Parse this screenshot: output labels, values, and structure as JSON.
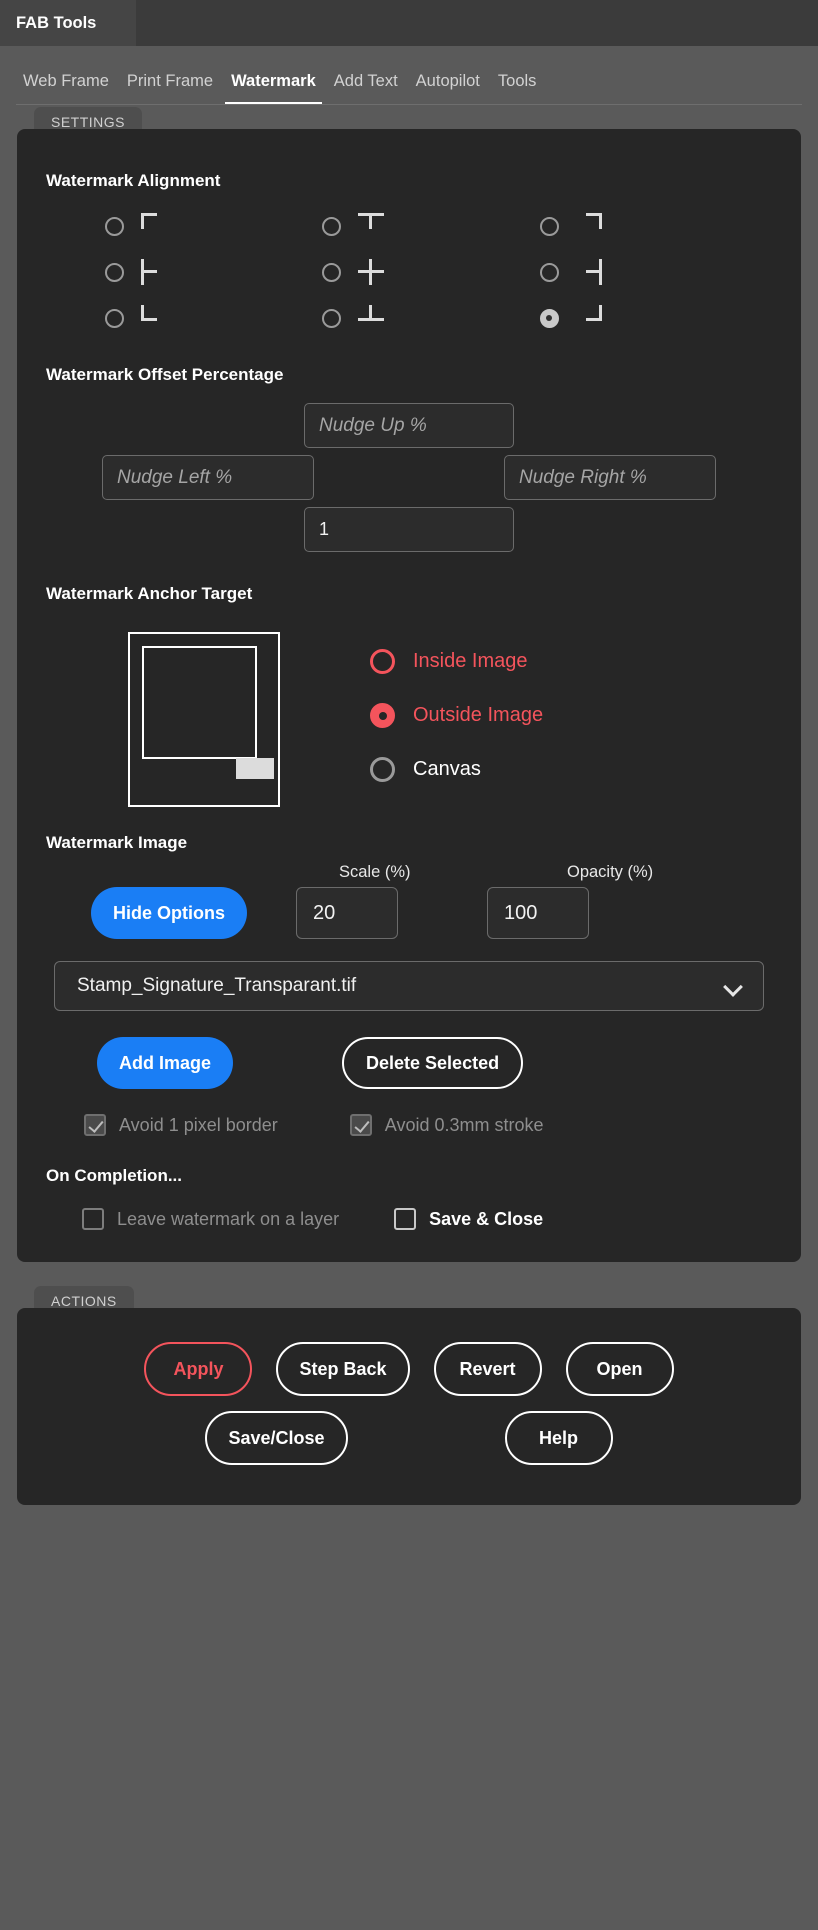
{
  "window": {
    "app_tab_label": "FAB Tools"
  },
  "nav": {
    "tabs": [
      {
        "label": "Web Frame",
        "active": false
      },
      {
        "label": "Print Frame",
        "active": false
      },
      {
        "label": "Watermark",
        "active": true
      },
      {
        "label": "Add Text",
        "active": false
      },
      {
        "label": "Autopilot",
        "active": false
      },
      {
        "label": "Tools",
        "active": false
      }
    ]
  },
  "settings_panel": {
    "tag": "SETTINGS",
    "alignment": {
      "title": "Watermark Alignment",
      "options": [
        {
          "name": "top-left",
          "selected": false
        },
        {
          "name": "top-center",
          "selected": false
        },
        {
          "name": "top-right",
          "selected": false
        },
        {
          "name": "middle-left",
          "selected": false
        },
        {
          "name": "middle-center",
          "selected": false
        },
        {
          "name": "middle-right",
          "selected": false
        },
        {
          "name": "bottom-left",
          "selected": false
        },
        {
          "name": "bottom-center",
          "selected": false
        },
        {
          "name": "bottom-right",
          "selected": true
        }
      ]
    },
    "offset": {
      "title": "Watermark Offset Percentage",
      "nudge_up_placeholder": "Nudge Up %",
      "nudge_up_value": "",
      "nudge_left_placeholder": "Nudge Left %",
      "nudge_left_value": "",
      "nudge_right_placeholder": "Nudge Right %",
      "nudge_right_value": "",
      "nudge_down_placeholder": "",
      "nudge_down_value": "1"
    },
    "anchor": {
      "title": "Watermark Anchor Target",
      "options": [
        {
          "label": "Inside Image",
          "selected": false,
          "color": "#f4545c"
        },
        {
          "label": "Outside Image",
          "selected": true,
          "color": "#f4545c"
        },
        {
          "label": "Canvas",
          "selected": false,
          "color": "#9a9a9a"
        }
      ]
    },
    "image": {
      "title": "Watermark Image",
      "scale_label": "Scale (%)",
      "scale_value": "20",
      "opacity_label": "Opacity (%)",
      "opacity_value": "100",
      "hide_options_label": "Hide Options",
      "selected_file": "Stamp_Signature_Transparant.tif",
      "add_image_label": "Add Image",
      "delete_selected_label": "Delete Selected",
      "avoid_border_label": "Avoid 1 pixel border",
      "avoid_border_checked": true,
      "avoid_stroke_label": "Avoid 0.3mm stroke",
      "avoid_stroke_checked": true
    },
    "on_completion": {
      "title": "On Completion...",
      "leave_layer_label": "Leave watermark on a layer",
      "leave_layer_checked": false,
      "save_close_label": "Save & Close",
      "save_close_checked": false
    }
  },
  "actions_panel": {
    "tag": "ACTIONS",
    "row1": [
      {
        "label": "Apply",
        "accent": "#f4545c"
      },
      {
        "label": "Step Back",
        "accent": "#ffffff"
      },
      {
        "label": "Revert",
        "accent": "#ffffff"
      },
      {
        "label": "Open",
        "accent": "#ffffff"
      }
    ],
    "row2": [
      {
        "label": "Save/Close",
        "accent": "#ffffff"
      },
      {
        "label": "Help",
        "accent": "#ffffff"
      }
    ]
  },
  "colors": {
    "accent_blue": "#1a7ef5",
    "accent_red": "#f4545c",
    "panel_bg": "#262626",
    "window_bg": "#5a5a5a"
  }
}
